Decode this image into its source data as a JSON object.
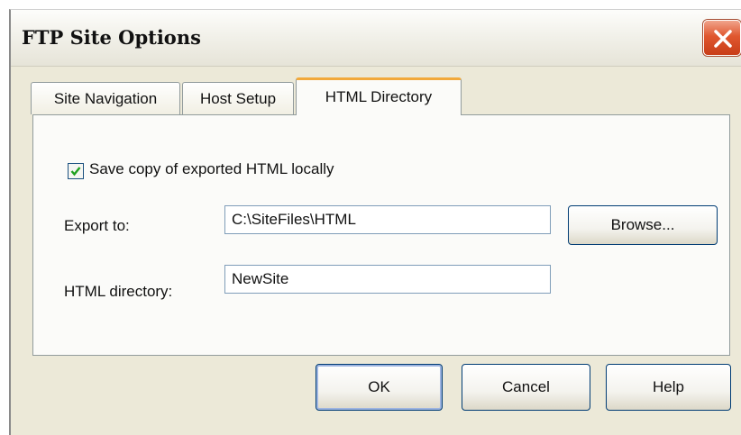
{
  "window": {
    "title": "FTP Site Options"
  },
  "tabs": [
    {
      "label": "Site Navigation",
      "active": false
    },
    {
      "label": "Host Setup",
      "active": false
    },
    {
      "label": "HTML Directory",
      "active": true
    }
  ],
  "panel": {
    "save_copy": {
      "label": "Save copy of exported HTML locally",
      "checked": true
    },
    "export_to": {
      "label": "Export to:",
      "value": "C:\\SiteFiles\\HTML"
    },
    "browse_label": "Browse...",
    "html_directory": {
      "label": "HTML directory:",
      "value": "NewSite"
    }
  },
  "buttons": {
    "ok": "OK",
    "cancel": "Cancel",
    "help": "Help"
  },
  "colors": {
    "window_bg": "#ece9d8",
    "close_red": "#e0572f",
    "tab_highlight": "#f2a93b",
    "check_green": "#21a121"
  },
  "icons": [
    "close-icon",
    "checkmark-icon"
  ]
}
